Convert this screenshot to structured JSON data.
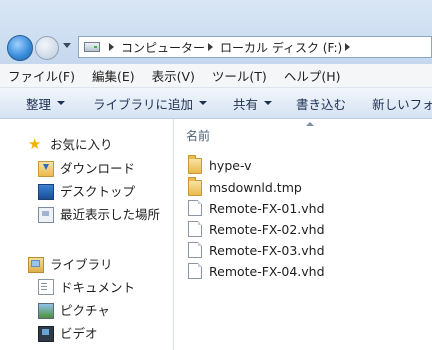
{
  "address": {
    "crumbs": [
      "コンピューター",
      "ローカル ディスク (F:)"
    ]
  },
  "menu": [
    "ファイル(F)",
    "編集(E)",
    "表示(V)",
    "ツール(T)",
    "ヘルプ(H)"
  ],
  "commands": {
    "organize": "整理",
    "add_to_library": "ライブラリに追加",
    "share": "共有",
    "burn": "書き込む",
    "new_folder": "新しいフォ"
  },
  "nav": {
    "favorites": "お気に入り",
    "downloads": "ダウンロード",
    "desktop": "デスクトップ",
    "recent": "最近表示した場所",
    "libraries": "ライブラリ",
    "documents": "ドキュメント",
    "pictures": "ピクチャ",
    "videos": "ビデオ"
  },
  "content": {
    "column_name": "名前",
    "files": [
      {
        "name": "hype-v",
        "type": "folder"
      },
      {
        "name": "msdownld.tmp",
        "type": "folder"
      },
      {
        "name": "Remote-FX-01.vhd",
        "type": "file"
      },
      {
        "name": "Remote-FX-02.vhd",
        "type": "file"
      },
      {
        "name": "Remote-FX-03.vhd",
        "type": "file"
      },
      {
        "name": "Remote-FX-04.vhd",
        "type": "file"
      }
    ]
  }
}
